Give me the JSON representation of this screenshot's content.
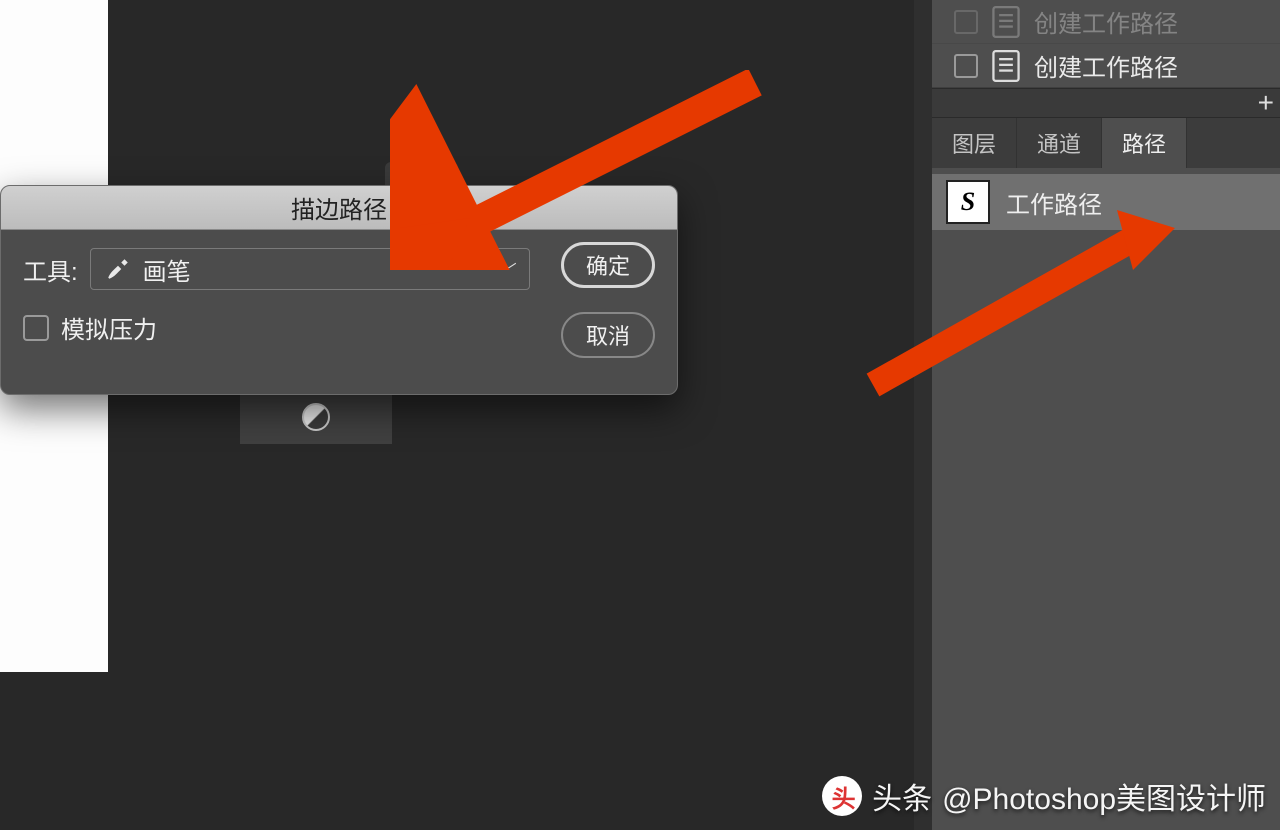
{
  "tab_bar": {
    "close_glyph": "✕",
    "expand_glyph": "››"
  },
  "dialog": {
    "title": "描边路径",
    "tool_label": "工具:",
    "tool_value": "画笔",
    "simulate_pressure": "模拟压力",
    "ok": "确定",
    "cancel": "取消"
  },
  "right": {
    "actions": [
      {
        "label": "创建工作路径",
        "faded": true
      },
      {
        "label": "创建工作路径",
        "faded": false
      }
    ],
    "tabs": {
      "layers": "图层",
      "channels": "通道",
      "paths": "路径",
      "active": "paths"
    },
    "path_item": {
      "thumb": "S",
      "label": "工作路径"
    }
  },
  "watermark": {
    "badge": "头",
    "text_prefix": "头条",
    "text_rest": " @Photoshop美图设计师"
  }
}
